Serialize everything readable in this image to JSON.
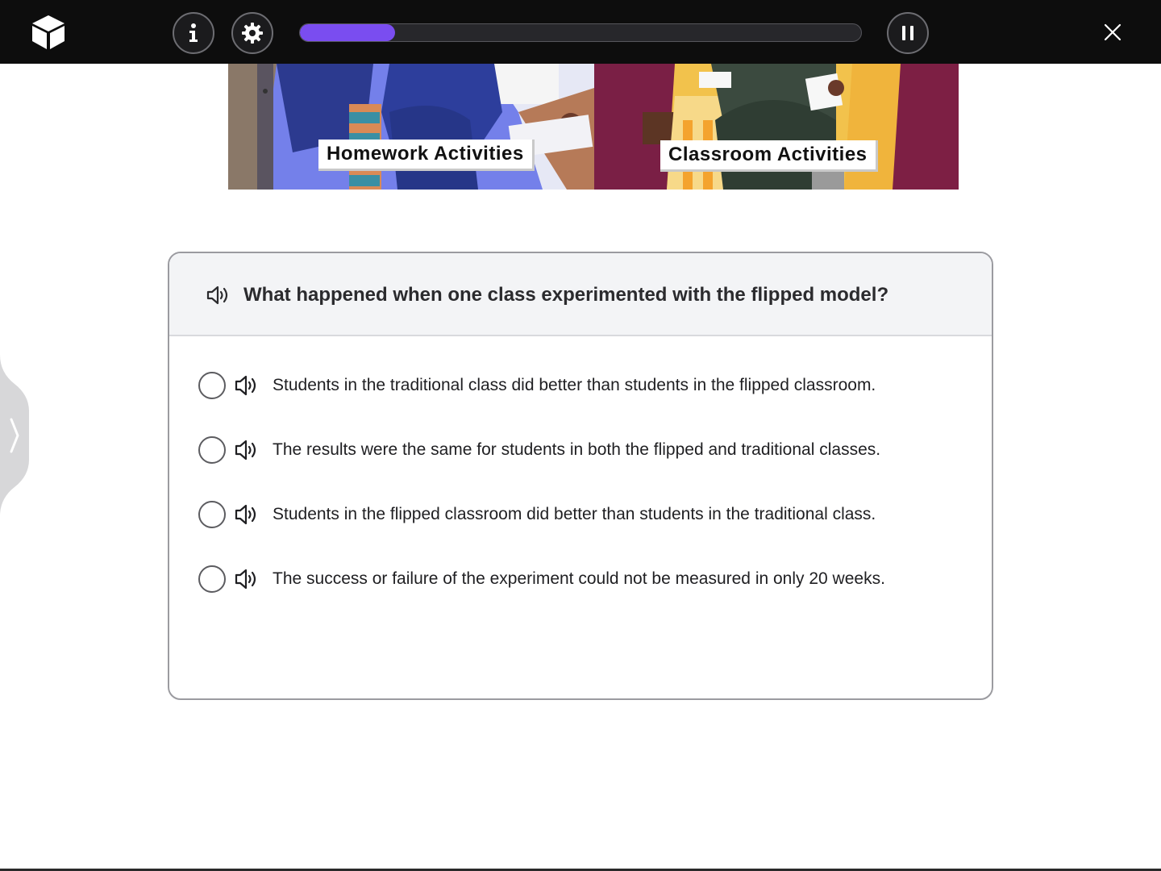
{
  "topbar": {
    "logo_icon": "cube-logo-icon",
    "info_icon": "info-icon",
    "settings_icon": "gear-icon",
    "pause_icon": "pause-icon",
    "close_icon": "close-icon",
    "progress_fraction": 0.17,
    "progress_color": "#7a4df0"
  },
  "banner": {
    "left_label": "Homework Activities",
    "right_label": "Classroom Activities"
  },
  "side_tab": {
    "icon": "chevron-right-icon"
  },
  "question": {
    "speaker_icon": "speaker-icon",
    "text": "What happened when one class experimented with the flipped model?",
    "options": [
      {
        "text": "Students in the traditional class did better than students in the flipped classroom."
      },
      {
        "text": "The results were the same for students in both the flipped and traditional classes."
      },
      {
        "text": "Students in the flipped classroom did better than students in the traditional class."
      },
      {
        "text": "The success or failure of the experiment could not be measured in only 20 weeks."
      }
    ]
  }
}
